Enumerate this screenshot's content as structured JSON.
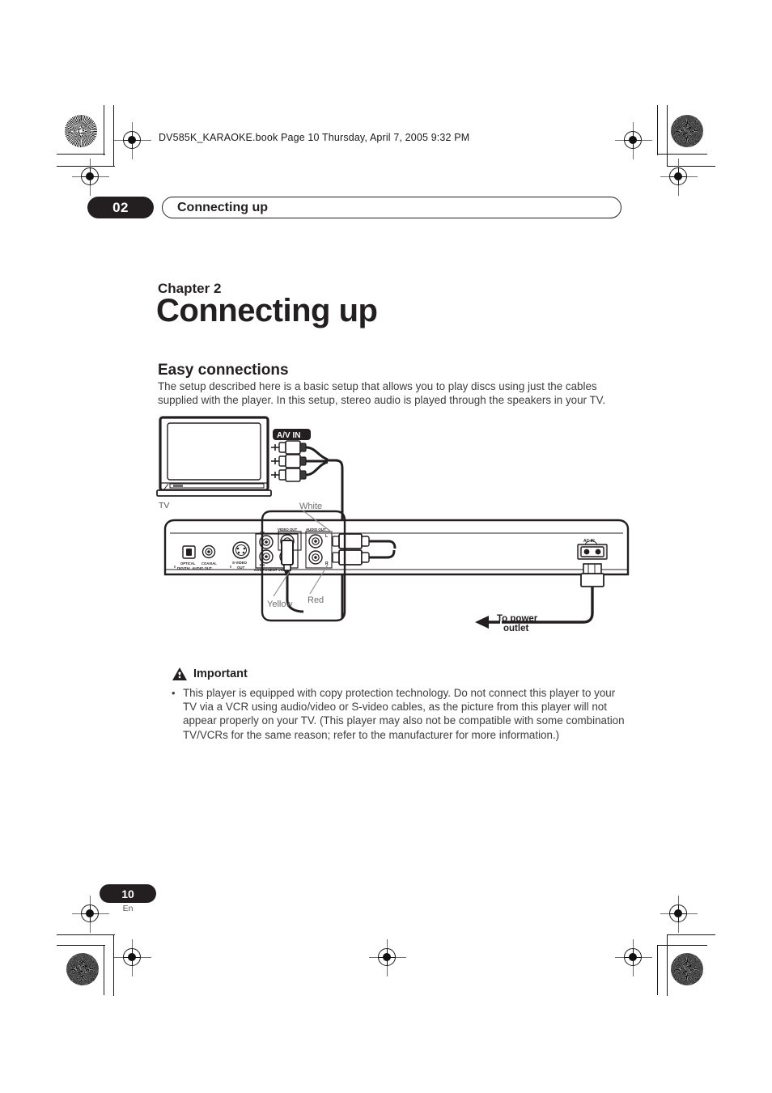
{
  "book_header": "DV585K_KARAOKE.book  Page 10  Thursday, April 7, 2005  9:32 PM",
  "chapter_tab": {
    "number": "02",
    "running_title": "Connecting up"
  },
  "chapter": {
    "eyebrow": "Chapter 2",
    "title": "Connecting up"
  },
  "section": {
    "title": "Easy connections",
    "body": "The setup described here is a basic setup that allows you to play discs using just the cables supplied with the player. In this setup, stereo audio is played through the speakers in your TV."
  },
  "diagram": {
    "tv_label": "TV",
    "av_in_badge": "A/V IN",
    "cable_labels": {
      "white": "White",
      "yellow": "Yellow",
      "red": "Red"
    },
    "power_label_line1": "To power",
    "power_label_line2": "outlet",
    "player_panel": {
      "optical": "OPTICAL",
      "coaxial": "COAXIAL",
      "digital_audio_out": "DIGITAL AUDIO OUT",
      "s_video": "S-VIDEO",
      "s_video_out": "OUT",
      "component_video": "COMPONENT VIDEO",
      "pb": "PB",
      "pr": "PR",
      "y": "Y",
      "video_out": "VIDEO OUT",
      "audio_out": "AUDIO OUT",
      "left": "L",
      "right": "R",
      "ac_in": "AC IN"
    }
  },
  "important": {
    "icon": "warning-triangle-icon",
    "heading": "Important",
    "bullet_marker": "•",
    "text": "This player is equipped with copy protection technology. Do not connect this player to your TV via a VCR using audio/video or S-video cables, as the picture from this player will not appear properly on your TV. (This player may also not be compatible with some combination TV/VCRs for the same reason; refer to the manufacturer for more information.)"
  },
  "footer": {
    "page_number": "10",
    "language": "En"
  },
  "colors": {
    "ink": "#231f20",
    "body_text": "#3d3d3d",
    "mark_gray": "#6f6f6f"
  }
}
